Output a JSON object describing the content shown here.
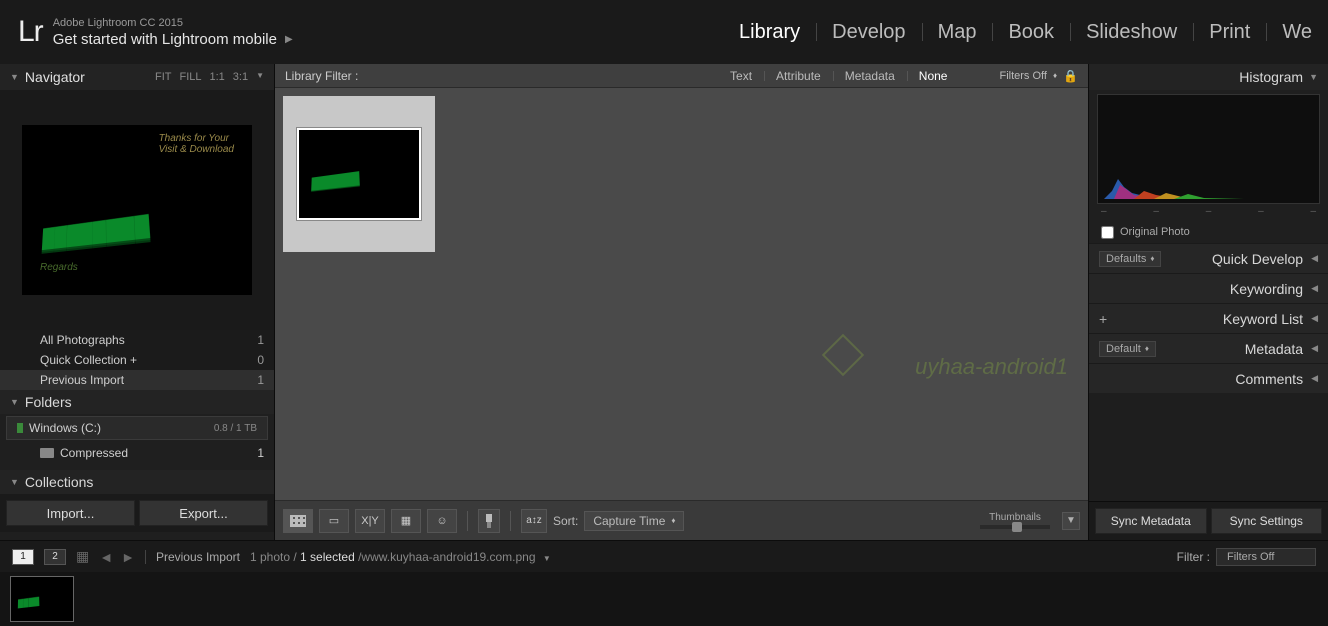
{
  "header": {
    "logo": "Lr",
    "app_title": "Adobe Lightroom CC 2015",
    "subtitle": "Get started with Lightroom mobile"
  },
  "modules": {
    "items": [
      "Library",
      "Develop",
      "Map",
      "Book",
      "Slideshow",
      "Print",
      "We"
    ],
    "active": "Library"
  },
  "navigator": {
    "title": "Navigator",
    "zoom": [
      "FIT",
      "FILL",
      "1:1",
      "3:1"
    ]
  },
  "catalog": {
    "items": [
      {
        "label": "All Photographs",
        "count": "1"
      },
      {
        "label": "Quick Collection  +",
        "count": "0"
      },
      {
        "label": "Previous Import",
        "count": "1"
      }
    ],
    "selected": 2
  },
  "folders": {
    "title": "Folders",
    "volume_name": "Windows (C:)",
    "volume_size": "0.8 / 1 TB",
    "folder_name": "Compressed",
    "folder_count": "1"
  },
  "collections": {
    "title": "Collections"
  },
  "left_buttons": {
    "import": "Import...",
    "export": "Export..."
  },
  "filterbar": {
    "label": "Library Filter :",
    "tabs": [
      "Text",
      "Attribute",
      "Metadata",
      "None"
    ],
    "active": "None",
    "filters_off": "Filters Off"
  },
  "toolbar": {
    "sort_label": "Sort:",
    "sort_value": "Capture Time",
    "thumbnails_label": "Thumbnails"
  },
  "right": {
    "histogram": "Histogram",
    "original_photo": "Original Photo",
    "sections": {
      "quick_develop": {
        "label": "Quick Develop",
        "preset": "Defaults"
      },
      "keywording": {
        "label": "Keywording"
      },
      "keyword_list": {
        "label": "Keyword List"
      },
      "metadata": {
        "label": "Metadata",
        "preset": "Default"
      },
      "comments": {
        "label": "Comments"
      }
    },
    "sync_metadata": "Sync Metadata",
    "sync_settings": "Sync Settings"
  },
  "bottombar": {
    "page1": "1",
    "page2": "2",
    "breadcrumb_source": "Previous Import",
    "photo_count": "1 photo /",
    "selected": "1 selected",
    "path": "/www.kuyhaa-android19.com.png",
    "filter_label": "Filter :",
    "filter_value": "Filters Off"
  },
  "watermark": "uyhaa-android1"
}
